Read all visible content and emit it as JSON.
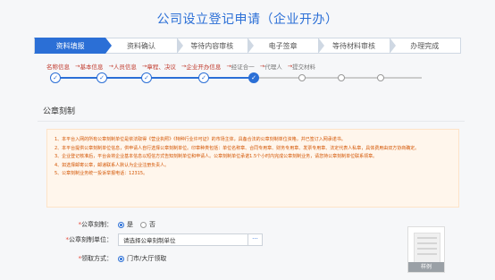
{
  "header": {
    "title": "公司设立登记申请（企业开办）"
  },
  "steps": [
    "资料填报",
    "资料确认",
    "等待内容审核",
    "电子签章",
    "等待材料审核",
    "办理完成"
  ],
  "substeps": [
    "名称信息",
    "基本信息",
    "人员信息",
    "章程、决议",
    "企业开办信息",
    "经证合一",
    "代理人",
    "提交材料"
  ],
  "section": {
    "title": "公章刻制"
  },
  "notice": {
    "lines": [
      "1、本平台入网的所有公章刻制单位是依法取得《营业执照》《特种行业许可证》的市场主体，具备合法的公章刻制单位资格，并已签订入网承诺书。",
      "2、本平台提供公章刻制单位信息，供申请人自行选择公章刻制单位。印章种类包括：单位名称章、合同专用章、财务专用章、发票专用章、法定代表人私章，具体费用由双方协商确定。",
      "3、企业登记核准后，平台会将企业基本信息以短信方式告知刻制单位和申请人。公章刻制单位承诺1.5个小时内完成公章刻制业务，请您持公章刻制单位联系领章。",
      "4、如选择邮寄公章，邮递联系人默认为企业注册负责人。",
      "5、公章刻制业务统一投诉举报电话：12315。"
    ]
  },
  "form": {
    "seal": {
      "label": "公章刻制：",
      "options": [
        "是",
        "否"
      ],
      "selected": "是"
    },
    "unit": {
      "label": "公章刻制单位：",
      "value": "请选择公章刻制单位",
      "btn": "···"
    },
    "pickup": {
      "label": "领取方式：",
      "option": "门市/大厅领取"
    },
    "sample_label": "样例"
  }
}
